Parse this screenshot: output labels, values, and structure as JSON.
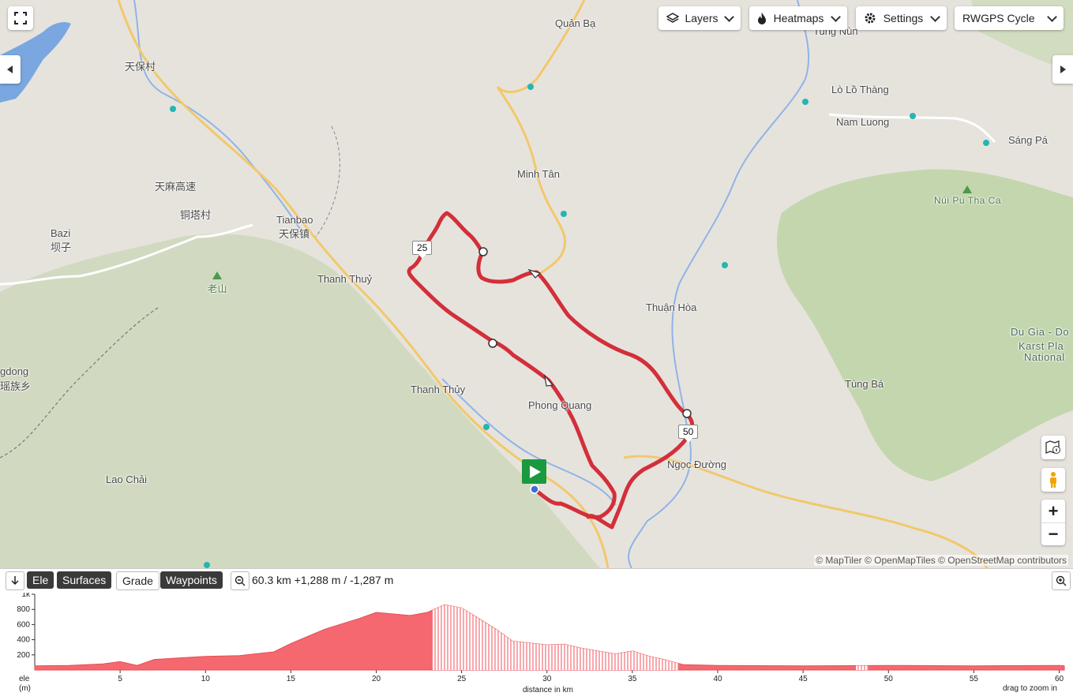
{
  "toolbar": {
    "layers_label": "Layers",
    "heatmaps_label": "Heatmaps",
    "settings_label": "Settings",
    "map_style_label": "RWGPS Cycle"
  },
  "map_labels": [
    {
      "text": "Quản Bạ",
      "kind": "town"
    },
    {
      "text": "Tung Nùn",
      "kind": "town"
    },
    {
      "text": "天保村",
      "kind": "town"
    },
    {
      "text": "Lò Lồ Thàng",
      "kind": "town"
    },
    {
      "text": "Nam Luong",
      "kind": "town"
    },
    {
      "text": "Sáng Pá",
      "kind": "town"
    },
    {
      "text": "天麻高速",
      "kind": "road"
    },
    {
      "text": "铜塔村",
      "kind": "town"
    },
    {
      "text": "Minh Tân",
      "kind": "town"
    },
    {
      "text": "Núi Pu Tha Ca",
      "kind": "peak"
    },
    {
      "text": "Tianbao",
      "kind": "town"
    },
    {
      "text": "天保镇",
      "kind": "town"
    },
    {
      "text": "Bazi",
      "kind": "town"
    },
    {
      "text": "坝子",
      "kind": "town"
    },
    {
      "text": "老山",
      "kind": "peak"
    },
    {
      "text": "Thanh Thuỷ",
      "kind": "town"
    },
    {
      "text": "Thuận Hòa",
      "kind": "town"
    },
    {
      "text": "Du Gia - Do",
      "kind": "park"
    },
    {
      "text": "Karst Pla",
      "kind": "park"
    },
    {
      "text": "National",
      "kind": "park"
    },
    {
      "text": "gdong",
      "kind": "town"
    },
    {
      "text": "瑶族乡",
      "kind": "town"
    },
    {
      "text": "Thanh Thủy",
      "kind": "town"
    },
    {
      "text": "Phong Quang",
      "kind": "town"
    },
    {
      "text": "Tùng Bá",
      "kind": "town"
    },
    {
      "text": "Ngọc Đường",
      "kind": "town"
    },
    {
      "text": "Lao Chải",
      "kind": "town"
    }
  ],
  "route_markers": [
    {
      "label": "25"
    },
    {
      "label": "50"
    }
  ],
  "attribution": "© MapTiler © OpenMapTiles © OpenStreetMap contributors",
  "profile": {
    "tabs": [
      {
        "label": "Ele",
        "active": true
      },
      {
        "label": "Surfaces",
        "active": true
      },
      {
        "label": "Grade",
        "active": false
      },
      {
        "label": "Waypoints",
        "active": true
      }
    ],
    "stats": "60.3 km +1,288 m / -1,287 m",
    "y_axis_label": "ele (m)",
    "x_axis_label": "distance in km",
    "hint": "drag to zoom in"
  },
  "chart_data": {
    "type": "area",
    "title": "",
    "xlabel": "distance in km",
    "ylabel": "ele (m)",
    "xlim": [
      0,
      60.3
    ],
    "ylim": [
      0,
      1000
    ],
    "y_ticks": [
      "200",
      "400",
      "600",
      "800",
      "1k"
    ],
    "x_ticks": [
      5,
      10,
      15,
      20,
      25,
      30,
      35,
      40,
      45,
      50,
      55,
      60
    ],
    "series": [
      {
        "x": [
          0,
          2,
          4,
          5,
          6,
          7,
          10,
          12,
          14,
          15,
          17,
          19,
          20,
          21,
          22,
          23,
          24,
          25,
          26,
          27,
          28,
          30,
          31,
          32,
          33,
          34,
          35,
          36,
          37,
          38,
          40,
          45,
          50,
          55,
          60,
          60.3
        ],
        "y": [
          55,
          60,
          80,
          110,
          60,
          140,
          180,
          190,
          240,
          350,
          540,
          680,
          760,
          740,
          720,
          760,
          860,
          820,
          680,
          540,
          380,
          330,
          340,
          290,
          250,
          210,
          250,
          180,
          130,
          70,
          60,
          55,
          60,
          55,
          60,
          55
        ]
      }
    ],
    "unpaved_segments": [
      [
        23.3,
        37.7
      ],
      [
        48.1,
        48.8
      ]
    ]
  }
}
